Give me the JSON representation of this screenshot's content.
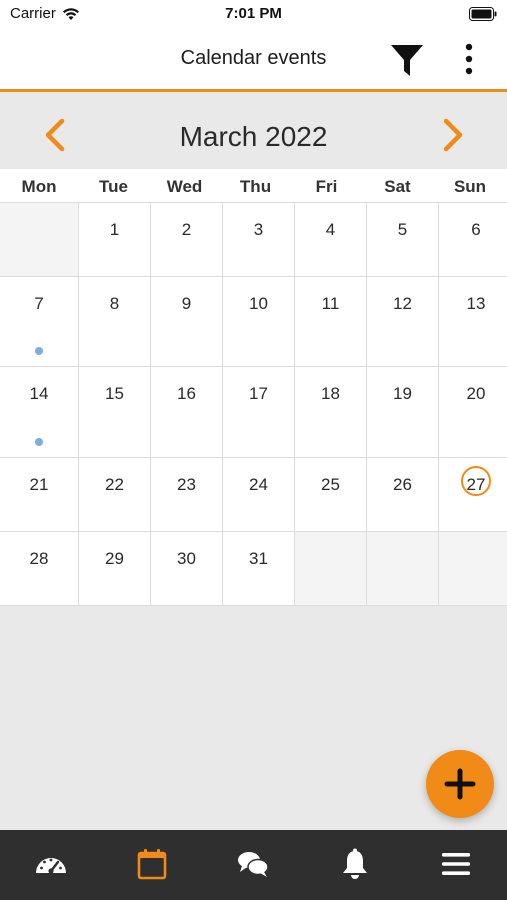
{
  "status_bar": {
    "carrier": "Carrier",
    "time": "7:01 PM"
  },
  "header": {
    "title": "Calendar events",
    "filter_icon": "filter-icon",
    "more_icon": "more-vertical-icon"
  },
  "calendar": {
    "month_label": "March 2022",
    "prev_icon": "chevron-left-icon",
    "next_icon": "chevron-right-icon",
    "weekdays": [
      "Mon",
      "Tue",
      "Wed",
      "Thu",
      "Fri",
      "Sat",
      "Sun"
    ],
    "weeks": [
      [
        "",
        "1",
        "2",
        "3",
        "4",
        "5",
        "6"
      ],
      [
        "7",
        "8",
        "9",
        "10",
        "11",
        "12",
        "13"
      ],
      [
        "14",
        "15",
        "16",
        "17",
        "18",
        "19",
        "20"
      ],
      [
        "21",
        "22",
        "23",
        "24",
        "25",
        "26",
        "27"
      ],
      [
        "28",
        "29",
        "30",
        "31",
        "",
        "",
        ""
      ]
    ],
    "today": "27",
    "event_days": [
      "7",
      "14"
    ]
  },
  "fab": {
    "icon": "plus-icon"
  },
  "bottom_nav": [
    {
      "icon": "dashboard-gauge-icon",
      "active": false
    },
    {
      "icon": "calendar-icon",
      "active": true
    },
    {
      "icon": "chat-bubbles-icon",
      "active": false
    },
    {
      "icon": "bell-icon",
      "active": false
    },
    {
      "icon": "hamburger-menu-icon",
      "active": false
    }
  ],
  "colors": {
    "accent": "#f28a17",
    "event_dot": "#7aaee0",
    "nav_bg": "#2f2f2f"
  }
}
